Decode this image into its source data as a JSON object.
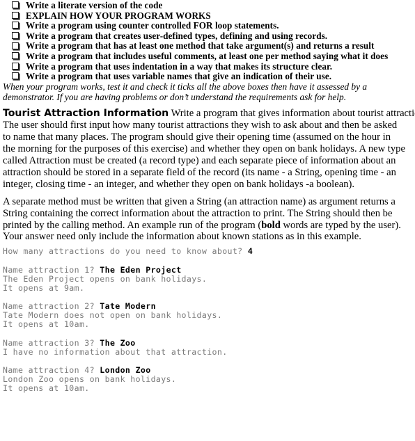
{
  "document": {
    "checklist": {
      "bullet_icon": "empty-checkbox-shadow",
      "items": [
        {
          "label": "Write a literate version of the code"
        },
        {
          "label": "EXPLAIN HOW YOUR PROGRAM WORKS"
        },
        {
          "label": "Write a program using counter controlled FOR loop statements."
        },
        {
          "label": "Write a program that creates user-defined types, defining and using records."
        },
        {
          "label": "Write a program that has at least one method that take argument(s) and returns a result"
        },
        {
          "label": "Write a program that includes useful comments, at least one per method saying what it does"
        },
        {
          "label": "Write a program that uses indentation in a way that makes its structure clear."
        },
        {
          "label": "Write a program that uses variable names that give an indication of their use."
        }
      ]
    },
    "note": {
      "lines": [
        "When your program works, test it and check it ticks all the above boxes then have it assessed by a",
        "demonstrator.  If you are having problems or don’t understand the requirements ask for help."
      ]
    },
    "section": {
      "heading": "Tourist Attraction Information",
      "intro_lines": [
        " Write a program that gives information about tourist attractions.",
        "The user should first input how many tourist attractions they wish to ask about and then be asked",
        "to name that many places. The program should give their opening time (assumed on the hour in",
        "the morning for the purposes of this exercise) and whether they open on bank holidays. A new type",
        "called Attraction must be created (a record type) and each separate piece of information about an",
        "attraction should be stored in a separate field of the record (its name - a String, opening time - an",
        "integer, closing time - an integer, and whether they open on bank holidays -a boolean)."
      ],
      "method_para": {
        "line1": "A separate method must be written that given a String (an attraction name) as argument returns a",
        "line2": "String containing the correct information about the attraction to print. The String should then be",
        "line3_pre": "printed by the calling method. An example run of the program (",
        "line3_bold": "bold",
        "line3_post": " words are typed by the user).",
        "line4": "Your answer need only include the information about known stations as in this example."
      }
    },
    "transcript": {
      "lines": [
        {
          "type": "text",
          "prompt": "How many attractions do you need to know about? ",
          "input": "4"
        },
        {
          "type": "blank"
        },
        {
          "type": "text",
          "prompt": "Name attraction 1? ",
          "input": "The Eden Project"
        },
        {
          "type": "text",
          "prompt": "The Eden Project opens on bank holidays.",
          "input": ""
        },
        {
          "type": "text",
          "prompt": "It opens at 9am.",
          "input": ""
        },
        {
          "type": "blank"
        },
        {
          "type": "text",
          "prompt": "Name attraction 2? ",
          "input": "Tate Modern"
        },
        {
          "type": "text",
          "prompt": "Tate Modern does not open on bank holidays.",
          "input": ""
        },
        {
          "type": "text",
          "prompt": "It opens at 10am.",
          "input": ""
        },
        {
          "type": "blank"
        },
        {
          "type": "text",
          "prompt": "Name attraction 3? ",
          "input": "The Zoo"
        },
        {
          "type": "text",
          "prompt": "I have no information about that attraction.",
          "input": ""
        },
        {
          "type": "blank"
        },
        {
          "type": "text",
          "prompt": "Name attraction 4? ",
          "input": "London Zoo"
        },
        {
          "type": "text",
          "prompt": "London Zoo opens on bank holidays.",
          "input": ""
        },
        {
          "type": "text",
          "prompt": "It opens at 10am.",
          "input": ""
        }
      ]
    },
    "colors": {
      "body_text": "#000000",
      "transcript_output": "#7a7a7a",
      "transcript_input": "#000000",
      "background": "#ffffff"
    }
  }
}
